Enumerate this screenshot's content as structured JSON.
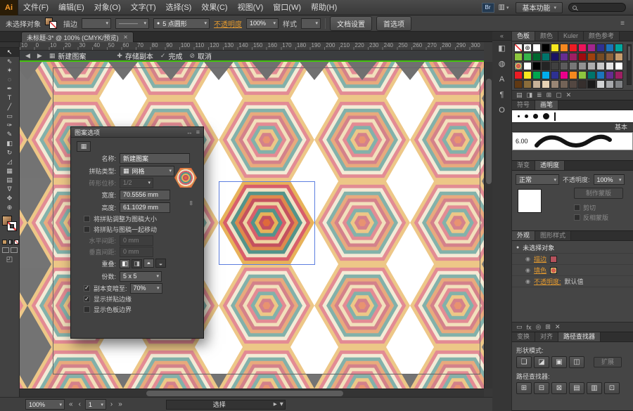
{
  "icons": {
    "back": "◀",
    "forward": "▶",
    "new_pattern": "▦",
    "save_copy": "✚",
    "done": "✓",
    "cancel": "⊘",
    "menu": "≡",
    "collapse": "↔",
    "link": "∞",
    "grid_tile": "▦",
    "registration": "⊕",
    "eye": "◉",
    "bullet": "●",
    "rail_collapse": "«",
    "screen_mode": "◰",
    "arrange_docs": "▥",
    "status_flyout": "▸",
    "status_menu": "▾",
    "nav_first": "«",
    "nav_prev": "‹",
    "nav_next": "›",
    "nav_last": "»",
    "control_menu": "≡",
    "pattern_tile_tool": "▦"
  },
  "menubar": {
    "logo": "Ai",
    "items": [
      {
        "name": "menu-file",
        "label": "文件(F)"
      },
      {
        "name": "menu-edit",
        "label": "编辑(E)"
      },
      {
        "name": "menu-object",
        "label": "对象(O)"
      },
      {
        "name": "menu-type",
        "label": "文字(T)"
      },
      {
        "name": "menu-select",
        "label": "选择(S)"
      },
      {
        "name": "menu-effect",
        "label": "效果(C)"
      },
      {
        "name": "menu-view",
        "label": "视图(V)"
      },
      {
        "name": "menu-window",
        "label": "窗口(W)"
      },
      {
        "name": "menu-help",
        "label": "帮助(H)"
      }
    ],
    "br_badge": "Br",
    "workspace": "基本功能"
  },
  "controlbar": {
    "no_selection_label": "未选择对象",
    "stroke_label": "描边",
    "stroke_value": "",
    "profile_value": "———",
    "brush_def": "5 点圆形",
    "opacity_label": "不透明度",
    "opacity_value": "100%",
    "style_label": "样式",
    "doc_setup_button": "文档设置",
    "preferences_button": "首选项"
  },
  "document_tab": {
    "title": "未标题-3* @ 100% (CMYK/预览)",
    "close": "×"
  },
  "pattern_bar": {
    "new_pattern": "新建图案",
    "save_copy": "存储副本",
    "done": "完成",
    "cancel": "取消"
  },
  "ruler_ticks": [
    "10",
    "0",
    "10",
    "20",
    "30",
    "40",
    "50",
    "60",
    "70",
    "80",
    "90",
    "100",
    "110",
    "120",
    "130",
    "140",
    "150",
    "160",
    "170",
    "180",
    "190",
    "200",
    "210",
    "220",
    "230",
    "240",
    "250",
    "260",
    "270",
    "280",
    "290",
    "300"
  ],
  "toolbar": {
    "tools": [
      {
        "name": "selection-tool",
        "glyph": "↖"
      },
      {
        "name": "direct-selection-tool",
        "glyph": "⇖"
      },
      {
        "name": "magic-wand-tool",
        "glyph": "✶"
      },
      {
        "name": "lasso-tool",
        "glyph": "◌"
      },
      {
        "name": "pen-tool",
        "glyph": "✒"
      },
      {
        "name": "type-tool",
        "glyph": "T"
      },
      {
        "name": "line-segment-tool",
        "glyph": "╱"
      },
      {
        "name": "rectangle-tool",
        "glyph": "▭"
      },
      {
        "name": "paintbrush-tool",
        "glyph": "✑"
      },
      {
        "name": "pencil-tool",
        "glyph": "✎"
      },
      {
        "name": "eraser-tool",
        "glyph": "◧"
      },
      {
        "name": "rotate-tool",
        "glyph": "↻"
      },
      {
        "name": "scale-tool",
        "glyph": "◿"
      },
      {
        "name": "mesh-tool",
        "glyph": "▦"
      },
      {
        "name": "gradient-tool",
        "glyph": "▤"
      },
      {
        "name": "eyedropper-tool",
        "glyph": "∇"
      },
      {
        "name": "hand-tool",
        "glyph": "✥"
      },
      {
        "name": "zoom-tool",
        "glyph": "⊕"
      }
    ]
  },
  "pattern_rings": [
    "#e7b259",
    "#d85f6b",
    "#f0e3c6",
    "#53948a",
    "#df8a4c",
    "#c4515e",
    "#eed4a2",
    "#d85f6b",
    "#53948a",
    "#e7b259",
    "#c4515e",
    "#df6a3a"
  ],
  "pattern_options": {
    "title": "图案选项",
    "name_label": "名称:",
    "name_value": "新建图案",
    "tile_type_label": "拼贴类型:",
    "tile_type_value": "网格",
    "brick_offset_label": "砖形位移:",
    "brick_offset_value": "1/2",
    "width_label": "宽度:",
    "width_value": "70.5556 mm",
    "height_label": "高度:",
    "height_value": "61.1029 mm",
    "size_tile_to_art": "将拼贴调整为图稿大小",
    "move_tile_with_art": "将拼贴与图稿一起移动",
    "h_spacing_label": "水平间距:",
    "h_spacing_value": "0 mm",
    "v_spacing_label": "垂直间距:",
    "v_spacing_value": "0 mm",
    "overlap_label": "重叠:",
    "overlap_buttons": [
      {
        "name": "overlap-left-in-front-button",
        "glyph": "◧"
      },
      {
        "name": "overlap-right-in-front-button",
        "glyph": "◨"
      },
      {
        "name": "overlap-top-in-front-button",
        "glyph": "◓"
      },
      {
        "name": "overlap-bottom-in-front-button",
        "glyph": "◒"
      }
    ],
    "copies_label": "份数:",
    "copies_value": "5 x 5",
    "dim_copies_label": "副本变暗至:",
    "dim_copies_value": "70%",
    "show_tile_edge": "显示拼贴边缘",
    "show_swatch_bounds": "显示色板边界"
  },
  "right_rail": {
    "icons": [
      {
        "name": "color-panel-icon",
        "glyph": "◧"
      },
      {
        "name": "color-guide-panel-icon",
        "glyph": "◍"
      },
      {
        "name": "character-panel-icon",
        "glyph": "A"
      },
      {
        "name": "paragraph-panel-icon",
        "glyph": "¶"
      },
      {
        "name": "opentype-panel-icon",
        "glyph": "O"
      }
    ]
  },
  "right_panels": {
    "swatches": {
      "tabs": [
        {
          "name": "tab-swatches",
          "label": "色板",
          "active": true
        },
        {
          "name": "tab-color",
          "label": "颜色",
          "active": false
        },
        {
          "name": "tab-kuler",
          "label": "Kuler",
          "active": false
        },
        {
          "name": "tab-color-guide",
          "label": "颜色参考",
          "active": false
        }
      ],
      "grid": [
        [
          "none",
          "reg",
          "#ffffff",
          "#000000",
          "#f7e81f",
          "#f6881f",
          "#ec1c24",
          "#ec145b",
          "#a3268e",
          "#2e3192",
          "#1b75bb",
          "#00a79d"
        ],
        [
          "#8dc63f",
          "#37b34a",
          "#00682f",
          "#00746b",
          "#1b1464",
          "#652d90",
          "#9e1f63",
          "#9e0b0f",
          "#9e410d",
          "#754c24",
          "#8c6239",
          "#c69c6d"
        ],
        [
          "pattern",
          "#ffffff",
          "#000000",
          "#242424",
          "#404040",
          "#5b5b5b",
          "#777777",
          "#929292",
          "#adadad",
          "#c9c9c9",
          "#e4e4e4",
          "#ffffff"
        ],
        [
          "#ec1c24",
          "#f7e81f",
          "#00a64f",
          "#00adee",
          "#2e3192",
          "#eb008b",
          "#f6881f",
          "#8dc63f",
          "#00746b",
          "#1b75bb",
          "#652d90",
          "#9e1f63"
        ],
        [
          "#603913",
          "#8a6d3b",
          "#c7b299",
          "#e6d2b5",
          "#998675",
          "#736357",
          "#534741",
          "#362f2d",
          "#1a1a1a",
          "#d1d3d4",
          "#a7a9ac",
          "#808285"
        ]
      ],
      "footer_icons": [
        {
          "name": "swatch-libraries-icon",
          "glyph": "▤"
        },
        {
          "name": "swatch-kinds-icon",
          "glyph": "◨"
        },
        {
          "name": "swatch-options-icon",
          "glyph": "≣"
        },
        {
          "name": "new-color-group-icon",
          "glyph": "⊞"
        },
        {
          "name": "new-swatch-icon",
          "glyph": "▢"
        },
        {
          "name": "delete-swatch-icon",
          "glyph": "✕"
        }
      ]
    },
    "brushes": {
      "tabs": [
        {
          "name": "tab-symbols",
          "label": "符号",
          "active": false
        },
        {
          "name": "tab-brushes",
          "label": "画笔",
          "active": true
        }
      ],
      "basic_label": "基本",
      "brush_size": "6.00"
    },
    "transparency": {
      "tabs": [
        {
          "name": "tab-gradient",
          "label": "渐变",
          "active": false
        },
        {
          "name": "tab-transparency",
          "label": "透明度",
          "active": true
        }
      ],
      "blend_mode": "正常",
      "opacity_label": "不透明度:",
      "opacity_value": "100%",
      "make_mask": "制作蒙版",
      "clip": "剪切",
      "invert_mask": "反相蒙版"
    },
    "appearance": {
      "tabs": [
        {
          "name": "tab-appearance",
          "label": "外观",
          "active": true
        },
        {
          "name": "tab-graphic-styles",
          "label": "图形样式",
          "active": false
        }
      ],
      "no_selection": "未选择对象",
      "stroke_label": "描边",
      "fill_label": "填色",
      "opacity_label": "不透明度:",
      "opacity_value": "默认值",
      "footer_icons": [
        {
          "name": "new-stroke-icon",
          "glyph": "▭"
        },
        {
          "name": "new-effect-icon",
          "glyph": "fx"
        },
        {
          "name": "clear-appearance-icon",
          "glyph": "◎"
        },
        {
          "name": "duplicate-item-icon",
          "glyph": "⊞"
        },
        {
          "name": "delete-item-icon",
          "glyph": "✕"
        }
      ]
    },
    "pathfinder": {
      "tabs": [
        {
          "name": "tab-transform",
          "label": "变换",
          "active": false
        },
        {
          "name": "tab-align",
          "label": "对齐",
          "active": false
        },
        {
          "name": "tab-pathfinder",
          "label": "路径查找器",
          "active": true
        }
      ],
      "shape_modes_label": "形状模式:",
      "shape_mode_buttons": [
        {
          "name": "unite-button",
          "glyph": "❏"
        },
        {
          "name": "minus-front-button",
          "glyph": "◪"
        },
        {
          "name": "intersect-button",
          "glyph": "▣"
        },
        {
          "name": "exclude-button",
          "glyph": "◫"
        }
      ],
      "expand_button": "扩展",
      "pathfinder_label": "路径查找器:",
      "pathfinder_buttons": [
        {
          "name": "divide-button",
          "glyph": "⊞"
        },
        {
          "name": "trim-button",
          "glyph": "⊟"
        },
        {
          "name": "merge-button",
          "glyph": "⊠"
        },
        {
          "name": "crop-button",
          "glyph": "▤"
        },
        {
          "name": "outline-button",
          "glyph": "▥"
        },
        {
          "name": "minus-back-button",
          "glyph": "⊡"
        }
      ]
    }
  },
  "statusbar": {
    "zoom": "100%",
    "artboard_number": "1",
    "status_text": "选择"
  }
}
